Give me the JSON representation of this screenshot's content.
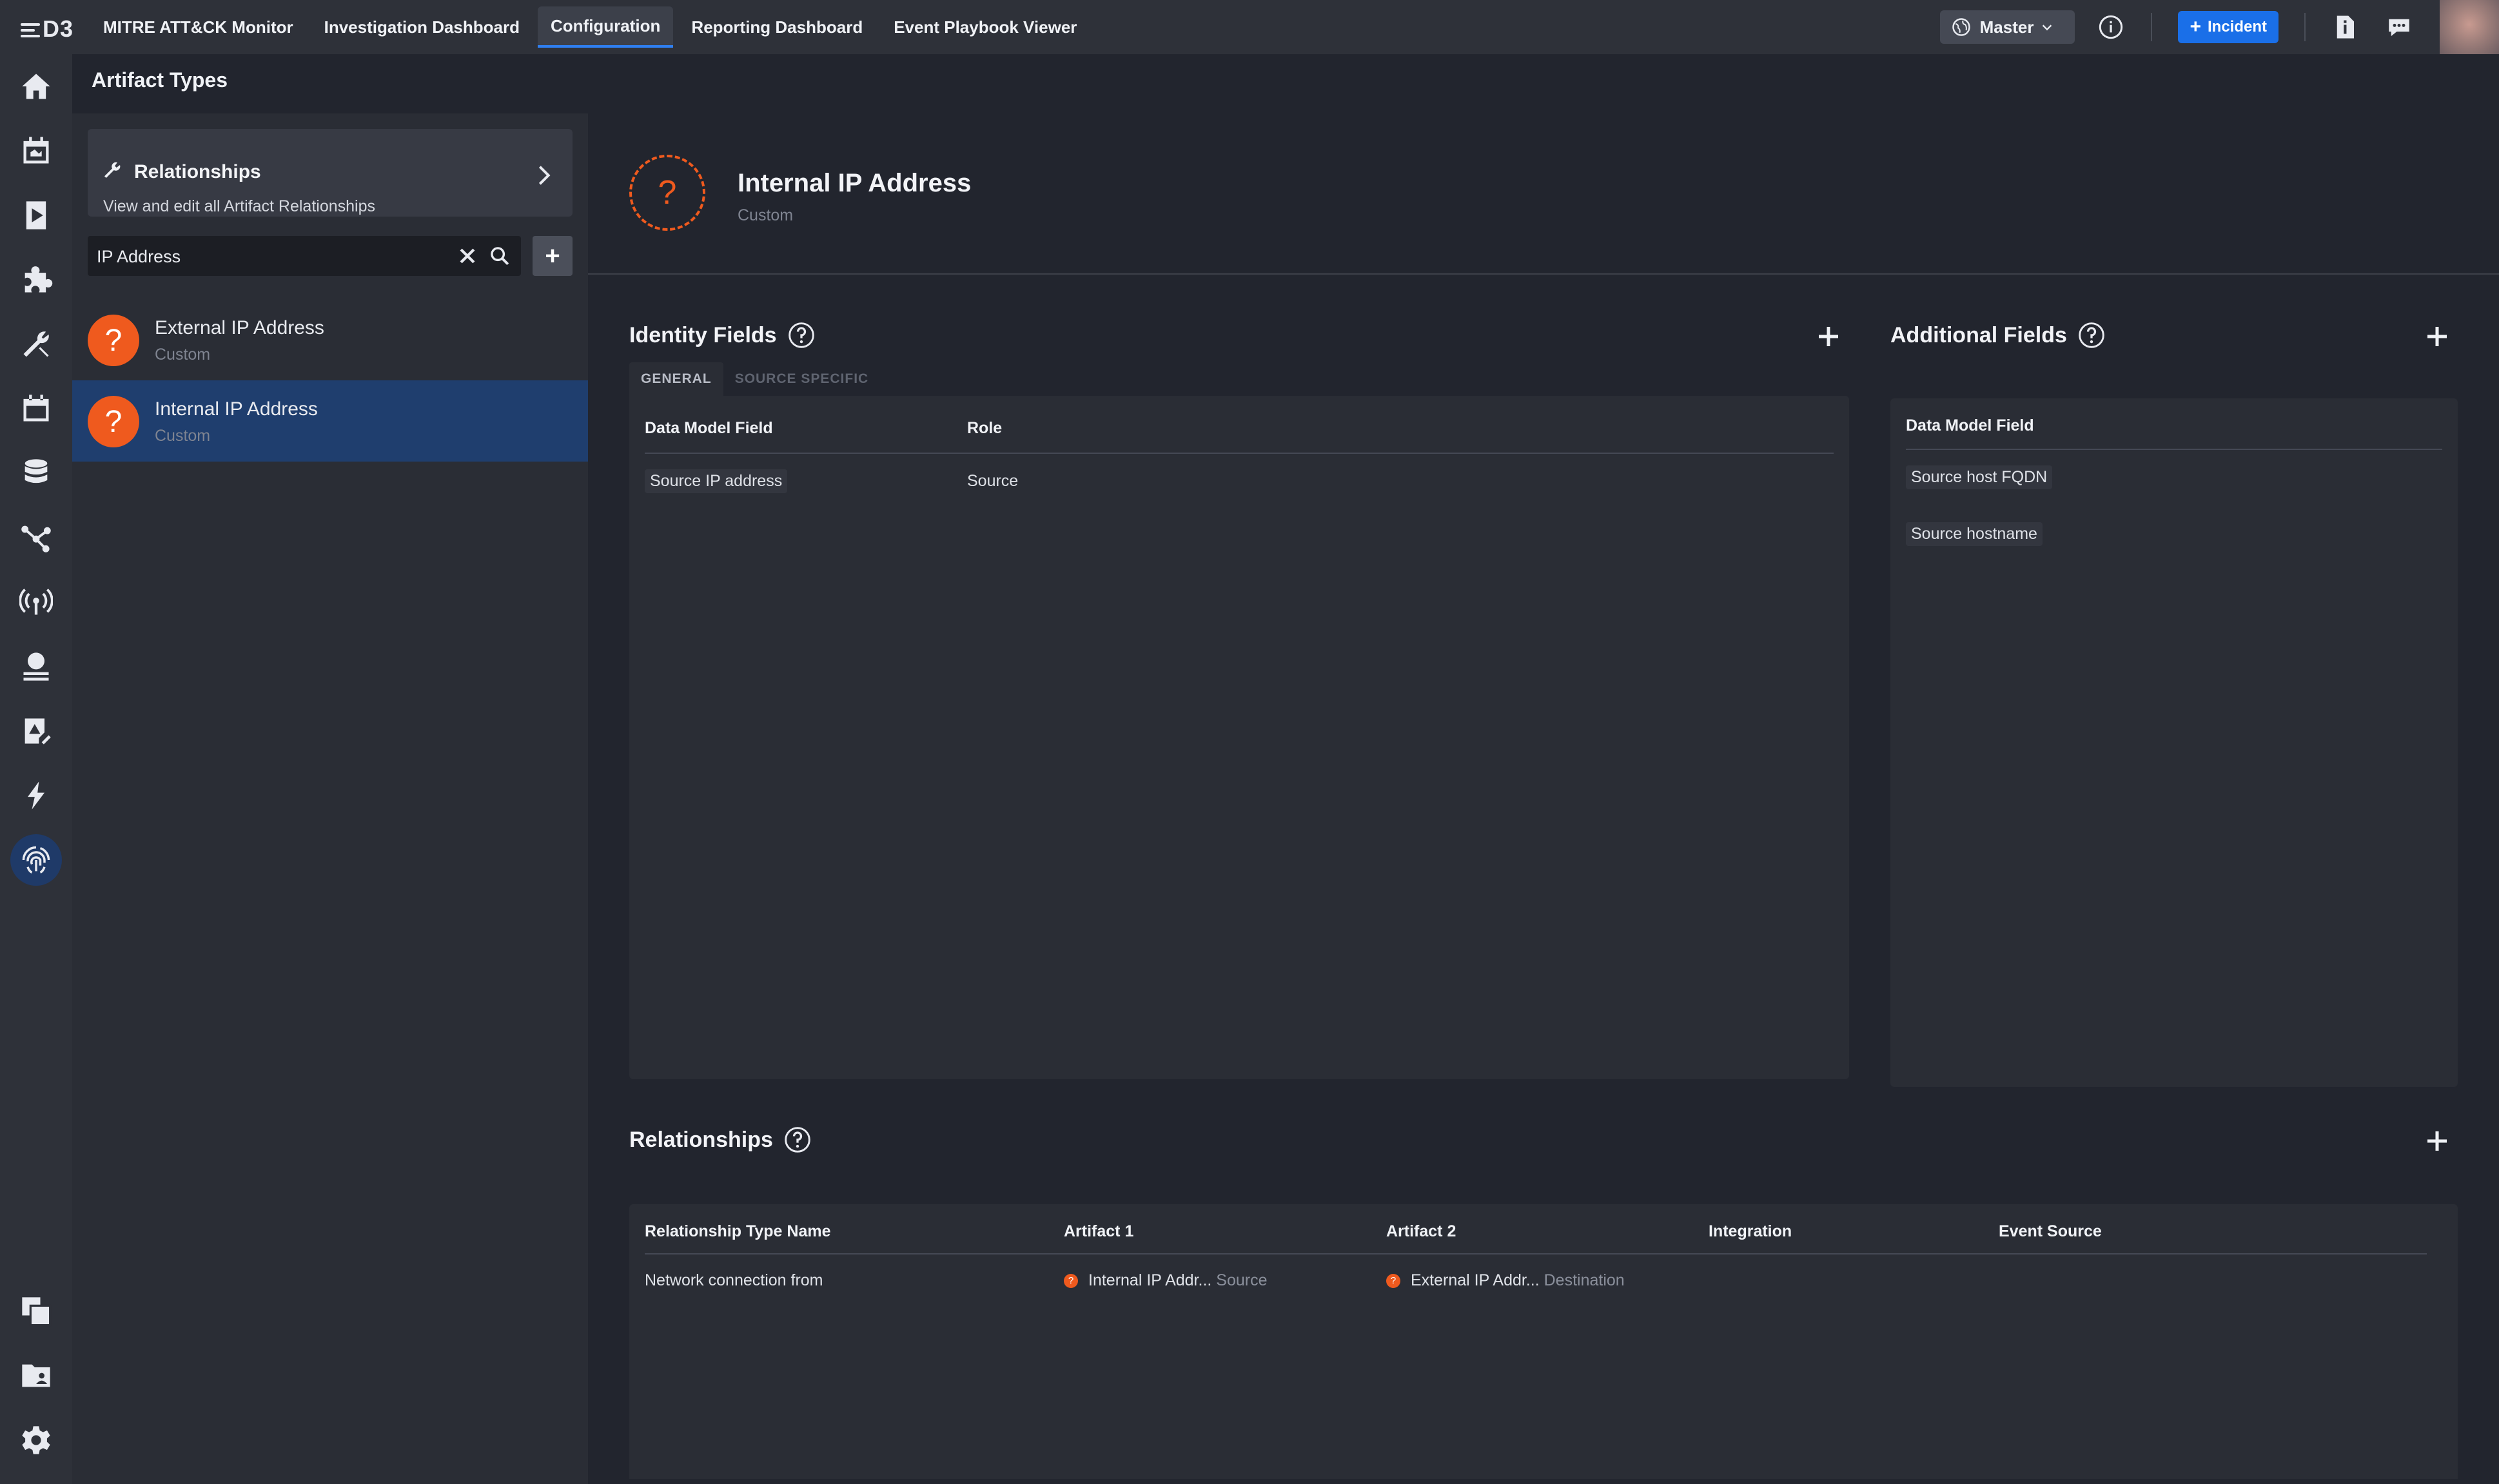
{
  "app": {
    "logo": "D3"
  },
  "nav": {
    "tabs": [
      {
        "label": "MITRE ATT&CK Monitor"
      },
      {
        "label": "Investigation Dashboard"
      },
      {
        "label": "Configuration"
      },
      {
        "label": "Reporting Dashboard"
      },
      {
        "label": "Event Playbook Viewer"
      }
    ],
    "active_tab": "Configuration",
    "master_label": "Master",
    "incident_label": "Incident"
  },
  "page": {
    "title": "Artifact Types"
  },
  "list": {
    "relationships_card": {
      "title": "Relationships",
      "subtitle": "View and edit all Artifact Relationships"
    },
    "search": {
      "value": "IP Address",
      "placeholder": ""
    },
    "items": [
      {
        "name": "External IP Address",
        "type": "Custom"
      },
      {
        "name": "Internal IP Address",
        "type": "Custom"
      }
    ],
    "selected_index": 1
  },
  "detail": {
    "title": "Internal IP Address",
    "subtitle": "Custom",
    "identity": {
      "title": "Identity Fields",
      "tabs": [
        "GENERAL",
        "SOURCE SPECIFIC"
      ],
      "active_tab": "GENERAL",
      "columns": [
        "Data Model Field",
        "Role"
      ],
      "rows": [
        {
          "field": "Source IP address",
          "role": "Source"
        }
      ]
    },
    "additional": {
      "title": "Additional Fields",
      "columns": [
        "Data Model Field"
      ],
      "rows": [
        "Source host FQDN",
        "Source hostname"
      ]
    },
    "relationships": {
      "title": "Relationships",
      "columns": [
        "Relationship Type Name",
        "Artifact 1",
        "Artifact 2",
        "Integration",
        "Event Source"
      ],
      "rows": [
        {
          "type_name": "Network connection from",
          "artifact1": "Internal IP Addr...",
          "artifact1_role": "Source",
          "artifact2": "External IP Addr...",
          "artifact2_role": "Destination",
          "integration": "",
          "event_source": ""
        }
      ]
    }
  },
  "colors": {
    "accent": "#1a6fe8",
    "artifact_orange": "#ef5a1e",
    "selected_row": "#1f3e6e"
  }
}
